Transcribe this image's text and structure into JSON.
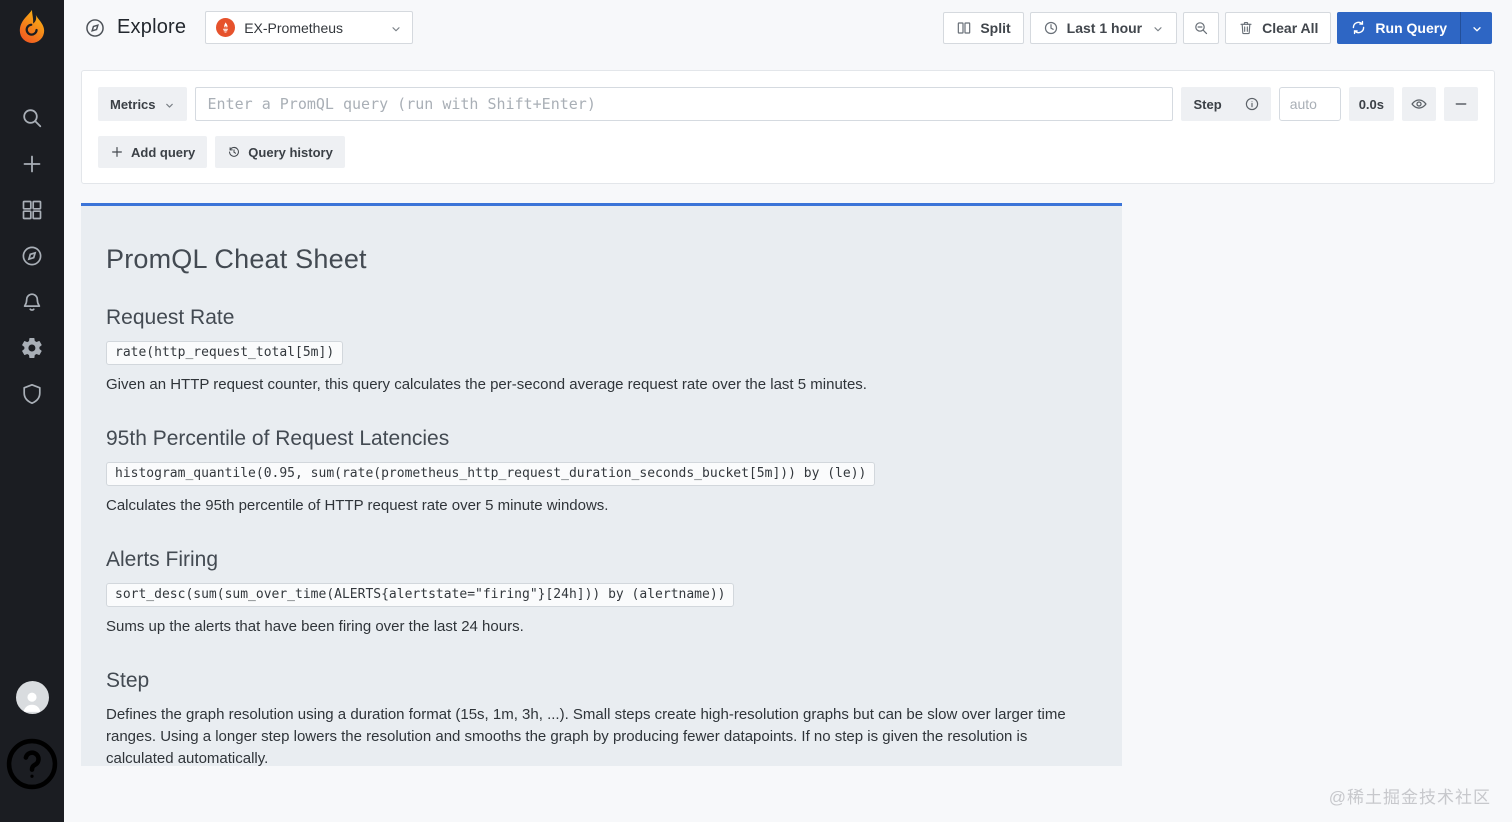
{
  "sidebar": {
    "logo_icon": "grafana-logo",
    "nav_icons": [
      "search-icon",
      "plus-icon",
      "dashboards-grid-icon",
      "compass-icon",
      "bell-icon",
      "gear-icon",
      "shield-icon"
    ],
    "bottom_icons": [
      "user-avatar",
      "help-question-icon"
    ]
  },
  "header": {
    "title": "Explore",
    "datasource_picker": {
      "icon": "prometheus-logo",
      "selected": "EX-Prometheus"
    },
    "toolbar": {
      "split_label": "Split",
      "time_range_label": "Last 1 hour",
      "clear_all_label": "Clear All",
      "run_query_label": "Run Query"
    }
  },
  "query_editor": {
    "mode_label": "Metrics",
    "query_placeholder": "Enter a PromQL query (run with Shift+Enter)",
    "step_label": "Step",
    "step_placeholder": "auto",
    "elapsed_time": "0.0s",
    "add_query_label": "Add query",
    "query_history_label": "Query history"
  },
  "cheat_sheet": {
    "title": "PromQL Cheat Sheet",
    "sections": [
      {
        "heading": "Request Rate",
        "code": "rate(http_request_total[5m])",
        "description": "Given an HTTP request counter, this query calculates the per-second average request rate over the last 5 minutes."
      },
      {
        "heading": "95th Percentile of Request Latencies",
        "code": "histogram_quantile(0.95, sum(rate(prometheus_http_request_duration_seconds_bucket[5m])) by (le))",
        "description": "Calculates the 95th percentile of HTTP request rate over 5 minute windows."
      },
      {
        "heading": "Alerts Firing",
        "code": "sort_desc(sum(sum_over_time(ALERTS{alertstate=\"firing\"}[24h])) by (alertname))",
        "description": "Sums up the alerts that have been firing over the last 24 hours."
      },
      {
        "heading": "Step",
        "description": "Defines the graph resolution using a duration format (15s, 1m, 3h, ...). Small steps create high-resolution graphs but can be slow over larger time ranges. Using a longer step lowers the resolution and smooths the graph by producing fewer datapoints. If no step is given the resolution is calculated automatically."
      }
    ]
  },
  "watermark": "@稀土掘金技术社区",
  "colors": {
    "accent_blue": "#2e66c4",
    "panel_border_blue": "#3b74d8",
    "panel_bg": "#e9edf1",
    "sidebar_bg": "#1b1d22",
    "prometheus_red": "#e6522c"
  }
}
